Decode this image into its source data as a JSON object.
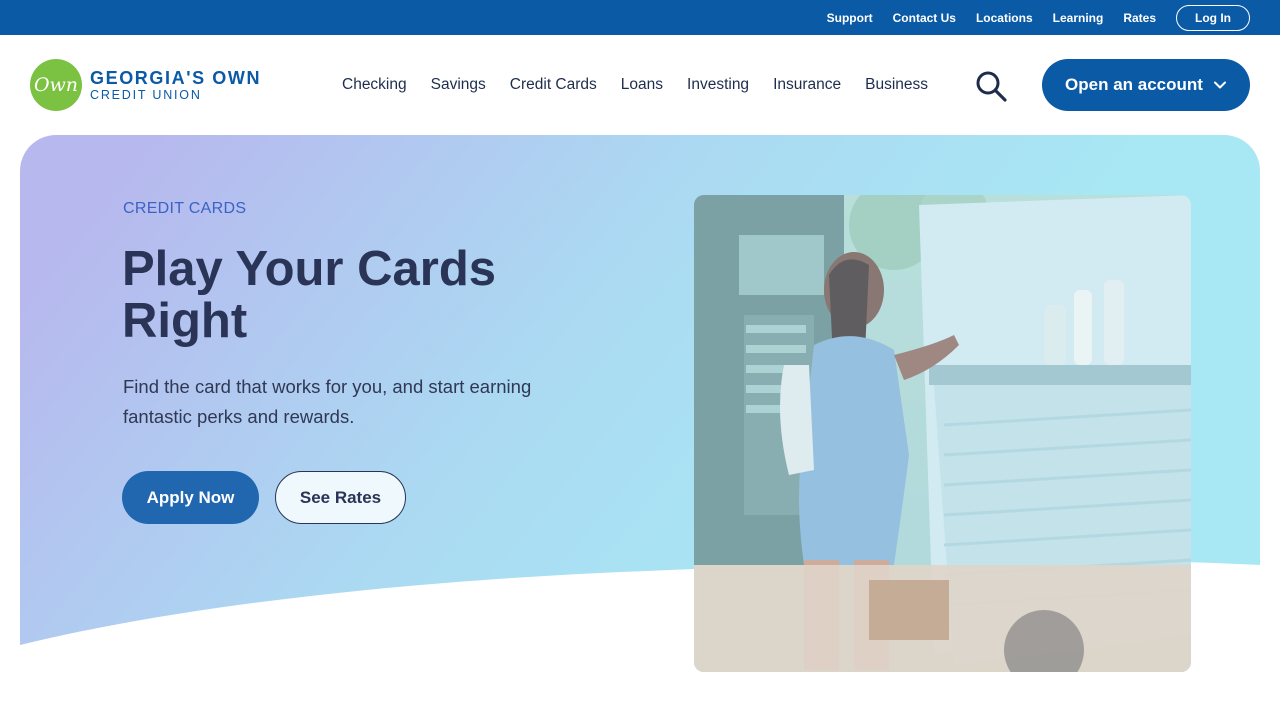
{
  "utility_nav": {
    "links": [
      "Support",
      "Contact Us",
      "Locations",
      "Learning",
      "Rates"
    ],
    "login_label": "Log In"
  },
  "logo": {
    "badge_text": "Own",
    "line1": "GEORGIA'S OWN",
    "line2": "CREDIT UNION"
  },
  "main_nav": {
    "items": [
      "Checking",
      "Savings",
      "Credit Cards",
      "Loans",
      "Investing",
      "Insurance",
      "Business"
    ],
    "search_icon": "search-icon",
    "cta_label": "Open an account",
    "cta_icon": "chevron-down-icon"
  },
  "hero": {
    "eyebrow": "CREDIT CARDS",
    "title": "Play Your Cards Right",
    "subtitle": "Find the card that works for you, and start earning fantastic perks and rewards.",
    "apply_label": "Apply Now",
    "rates_label": "See Rates"
  },
  "colors": {
    "brand_blue": "#0a5aa6",
    "logo_green": "#7cc242",
    "hero_gradient_start": "#b7b8ee",
    "hero_gradient_end": "#a8e8f4"
  }
}
